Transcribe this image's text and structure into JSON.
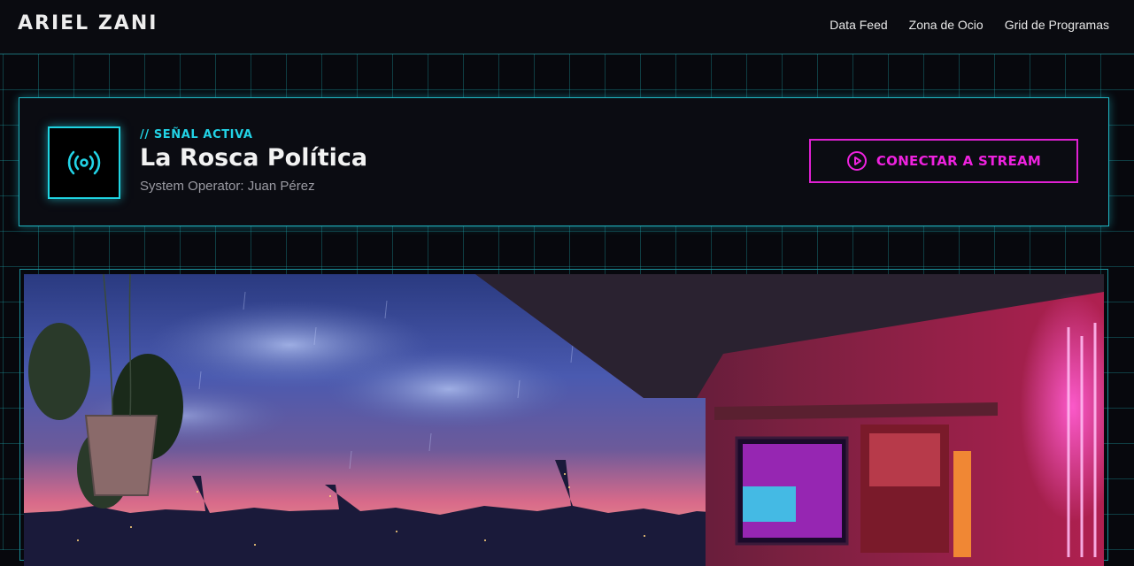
{
  "header": {
    "brand": "ARIEL ZANI",
    "nav": [
      "Data Feed",
      "Zona de Ocio",
      "Grid de Programas"
    ]
  },
  "signal": {
    "eyebrow": "// SEÑAL ACTIVA",
    "title": "La Rosca Política",
    "operator": "System Operator: Juan Pérez",
    "icon": "broadcast-icon",
    "button_label": "CONECTAR A STREAM",
    "button_icon": "play-circle-icon"
  },
  "media": {
    "scene": "cyberpunk-balcony-city-night-rain"
  },
  "colors": {
    "background": "#07080d",
    "grid": "#1eaaaf",
    "cyan_accent": "#22d3e6",
    "magenta_accent": "#ee22de",
    "text_primary": "#f2f2f2",
    "text_muted": "#9a9aa2"
  }
}
